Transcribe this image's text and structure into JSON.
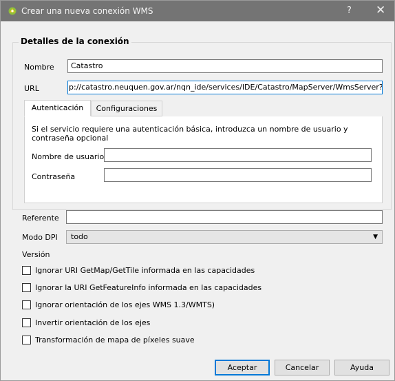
{
  "window": {
    "title": "Crear una nueva conexión WMS",
    "help": "?",
    "close": "✕"
  },
  "group": {
    "title": "Detalles de la conexión",
    "name_label": "Nombre",
    "name_value": "Catastro",
    "url_label": "URL",
    "url_value": "p://catastro.neuquen.gov.ar/nqn_ide/services/IDE/Catastro/MapServer/WmsServer?"
  },
  "tabs": {
    "auth": "Autenticación",
    "config": "Configuraciones",
    "info": "Si el servicio requiere una autenticación básica, introduzca un nombre de usuario y contraseña opcional",
    "user_label": "Nombre de usuario",
    "password_label": "Contraseña",
    "user_value": "",
    "password_value": ""
  },
  "referer": {
    "label": "Referente",
    "value": ""
  },
  "dpi": {
    "label": "Modo DPI",
    "selected": "todo"
  },
  "version_label": "Versión",
  "checkboxes": [
    {
      "label": "Ignorar URI GetMap/GetTile informada en las capacidades",
      "checked": false
    },
    {
      "label": "Ignorar la URI GetFeatureInfo informada en las capacidades",
      "checked": false
    },
    {
      "label": "Ignorar orientación de los ejes WMS 1.3/WMTS)",
      "checked": false
    },
    {
      "label": "Invertir orientación de los ejes",
      "checked": false
    },
    {
      "label": "Transformación de mapa de píxeles suave",
      "checked": false
    }
  ],
  "buttons": {
    "ok": "Aceptar",
    "cancel": "Cancelar",
    "help": "Ayuda"
  },
  "colors": {
    "titlebar": "#747474",
    "focus": "#0078d7"
  }
}
